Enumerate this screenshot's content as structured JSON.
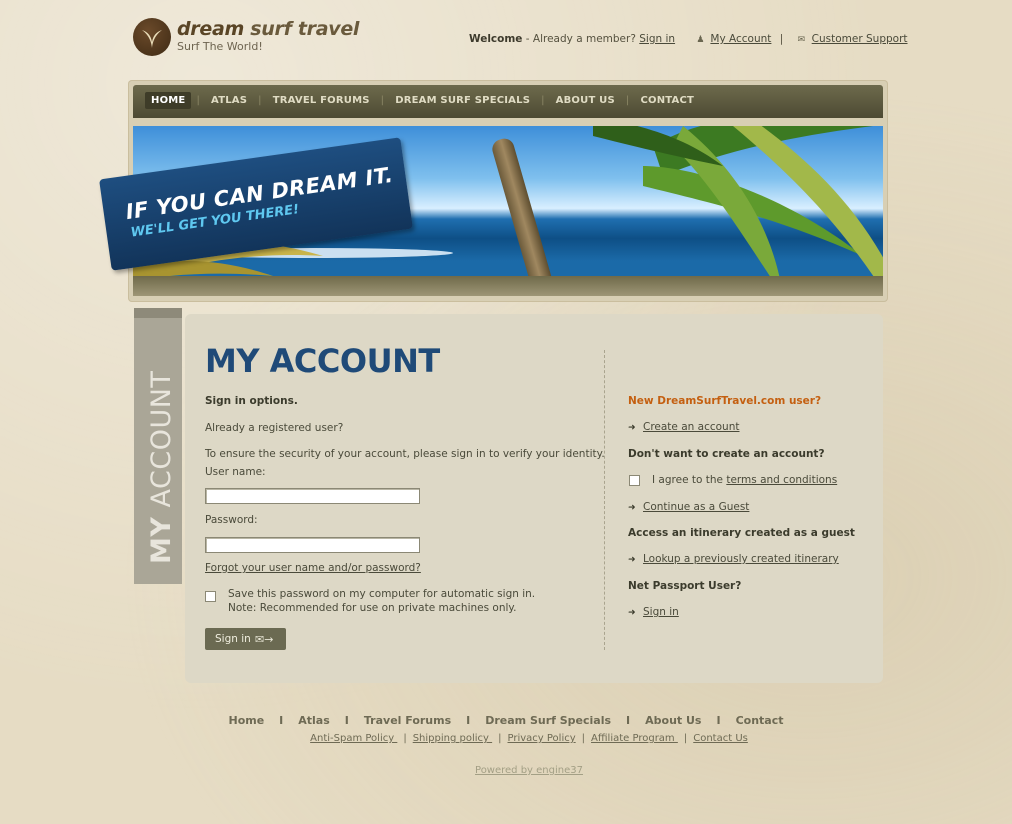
{
  "header": {
    "logo_title_1": "dream",
    "logo_title_2": " surf travel",
    "logo_tagline": "Surf The World!",
    "welcome": "Welcome",
    "already_member": " - Already a member? ",
    "sign_in": "Sign in",
    "my_account": "My Account",
    "separator": "|",
    "customer_support": "Customer Support"
  },
  "menu": {
    "items": [
      {
        "label": "HOME"
      },
      {
        "label": "ATLAS"
      },
      {
        "label": "TRAVEL FORUMS"
      },
      {
        "label": "DREAM SURF SPECIALS"
      },
      {
        "label": "ABOUT US"
      },
      {
        "label": "CONTACT"
      }
    ],
    "active": "HOME"
  },
  "banner": {
    "line1": "IF YOU CAN DREAM IT.",
    "line2": "WE'LL GET YOU THERE!"
  },
  "sidetab": {
    "bold": "MY",
    "rest": " ACCOUNT"
  },
  "page_title": "MY ACCOUNT",
  "left": {
    "sign_in_options": "Sign in options.",
    "already_registered": "Already a registered user?",
    "security_note": "To ensure the security of your account, please sign in to verify your identity.",
    "username_label": "User name:",
    "username_value": "",
    "password_label": "Password:",
    "password_value": "",
    "forgot": "Forgot your user name and/or password?",
    "save_password": "Save this password on my computer for automatic sign in.",
    "save_note": "Note: Recommended for use on private machines only.",
    "signin_button": "Sign in"
  },
  "right": {
    "new_user": "New DreamSurfTravel.com user?",
    "create_account": "Create an account",
    "dont_want": "Don't want to create an account?",
    "agree_prefix": "I agree to the ",
    "terms": "terms and conditions",
    "continue_guest": "Continue as a Guest",
    "access_itinerary": "Access an itinerary created as a guest",
    "lookup_itinerary": "Lookup a previously created itinerary",
    "net_passport": "Net Passport User?",
    "sign_in": "Sign in"
  },
  "footer": {
    "nav": [
      "Home",
      "Atlas",
      "Travel Forums",
      "Dream Surf Specials",
      "About Us",
      "Contact"
    ],
    "nav_sep": "I",
    "links": [
      "Anti-Spam Policy ",
      "Shipping policy ",
      "Privacy Policy",
      "Affiliate Program ",
      "Contact Us"
    ],
    "link_sep": "|",
    "powered": "Powered by engine37"
  },
  "colors": {
    "accent_blue": "#1f4a78",
    "orange": "#c45f10",
    "menu_bg": "#5d5a40"
  }
}
